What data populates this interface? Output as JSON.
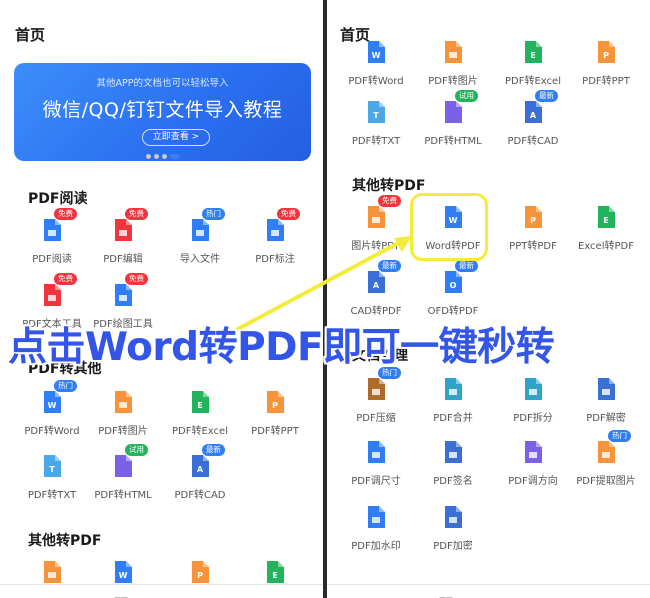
{
  "colors": {
    "blue": "#2f7ef5",
    "red": "#f0363c",
    "green": "#22b35c",
    "orange": "#f7933a",
    "purple": "#7b61e8",
    "caption": "#3355e8",
    "highlight": "#f4ec3a"
  },
  "left": {
    "title": "首页",
    "banner": {
      "subtitle": "其他APP的文档也可以轻松导入",
      "title": "微信/QQ/钉钉文件导入教程",
      "button": "立即查看 >"
    },
    "sections": [
      {
        "title": "PDF阅读"
      },
      {
        "title": "PDF转其他"
      },
      {
        "title": "其他转PDF"
      }
    ],
    "tools": [
      {
        "label": "PDF阅读",
        "badge": "免费",
        "icon": "book-icon"
      },
      {
        "label": "PDF编辑",
        "badge": "免费",
        "icon": "edit-icon"
      },
      {
        "label": "导入文件",
        "badge": "热门",
        "icon": "import-icon"
      },
      {
        "label": "PDF标注",
        "badge": "免费",
        "icon": "pin-icon"
      },
      {
        "label": "PDF文本工具",
        "badge": "免费",
        "icon": "text-tool-icon"
      },
      {
        "label": "PDF绘图工具",
        "badge": "免费",
        "icon": "draw-icon"
      },
      {
        "label": "PDF转Word",
        "badge": "热门",
        "icon": "word-icon"
      },
      {
        "label": "PDF转图片",
        "badge": "",
        "icon": "image-icon"
      },
      {
        "label": "PDF转Excel",
        "badge": "",
        "icon": "excel-icon"
      },
      {
        "label": "PDF转PPT",
        "badge": "",
        "icon": "ppt-icon"
      },
      {
        "label": "PDF转TXT",
        "badge": "",
        "icon": "txt-icon"
      },
      {
        "label": "PDF转HTML",
        "badge": "试用",
        "icon": "html-icon"
      },
      {
        "label": "PDF转CAD",
        "badge": "最新",
        "icon": "cad-icon"
      }
    ]
  },
  "right": {
    "title": "首页",
    "sections": [
      {
        "title": "其他转PDF"
      },
      {
        "title": "文档处理"
      }
    ],
    "top_tools": [
      {
        "label": "PDF转Word",
        "icon": "word-icon"
      },
      {
        "label": "PDF转图片",
        "icon": "image-icon"
      },
      {
        "label": "PDF转Excel",
        "icon": "excel-icon"
      },
      {
        "label": "PDF转PPT",
        "icon": "ppt-icon"
      },
      {
        "label": "PDF转TXT",
        "badge": "",
        "icon": "txt-icon"
      },
      {
        "label": "PDF转HTML",
        "badge": "试用",
        "icon": "html-icon"
      },
      {
        "label": "PDF转CAD",
        "badge": "最新",
        "icon": "cad-icon"
      }
    ],
    "other_to_pdf": [
      {
        "label": "图片转PDF",
        "badge": "免费",
        "icon": "image-icon"
      },
      {
        "label": "Word转PDF",
        "badge": "",
        "icon": "word-icon"
      },
      {
        "label": "PPT转PDF",
        "badge": "",
        "icon": "ppt-icon"
      },
      {
        "label": "Excel转PDF",
        "badge": "",
        "icon": "excel-icon"
      },
      {
        "label": "CAD转PDF",
        "badge": "最新",
        "icon": "cad-icon"
      },
      {
        "label": "OFD转PDF",
        "badge": "最新",
        "icon": "ofd-icon"
      }
    ],
    "doc_processing": [
      {
        "label": "PDF压缩",
        "badge": "热门",
        "icon": "compress-icon"
      },
      {
        "label": "PDF合并",
        "badge": "",
        "icon": "merge-icon"
      },
      {
        "label": "PDF拆分",
        "badge": "",
        "icon": "split-icon"
      },
      {
        "label": "PDF解密",
        "badge": "",
        "icon": "unlock-icon"
      },
      {
        "label": "PDF调尺寸",
        "badge": "",
        "icon": "resize-icon"
      },
      {
        "label": "PDF签名",
        "badge": "",
        "icon": "sign-icon"
      },
      {
        "label": "PDF调方向",
        "badge": "",
        "icon": "rotate-icon"
      },
      {
        "label": "PDF提取图片",
        "badge": "热门",
        "icon": "extract-image-icon"
      },
      {
        "label": "PDF加水印",
        "badge": "",
        "icon": "watermark-icon"
      },
      {
        "label": "PDF加密",
        "badge": "",
        "icon": "encrypt-icon"
      }
    ]
  },
  "caption": "点击Word转PDF即可一键秒转"
}
